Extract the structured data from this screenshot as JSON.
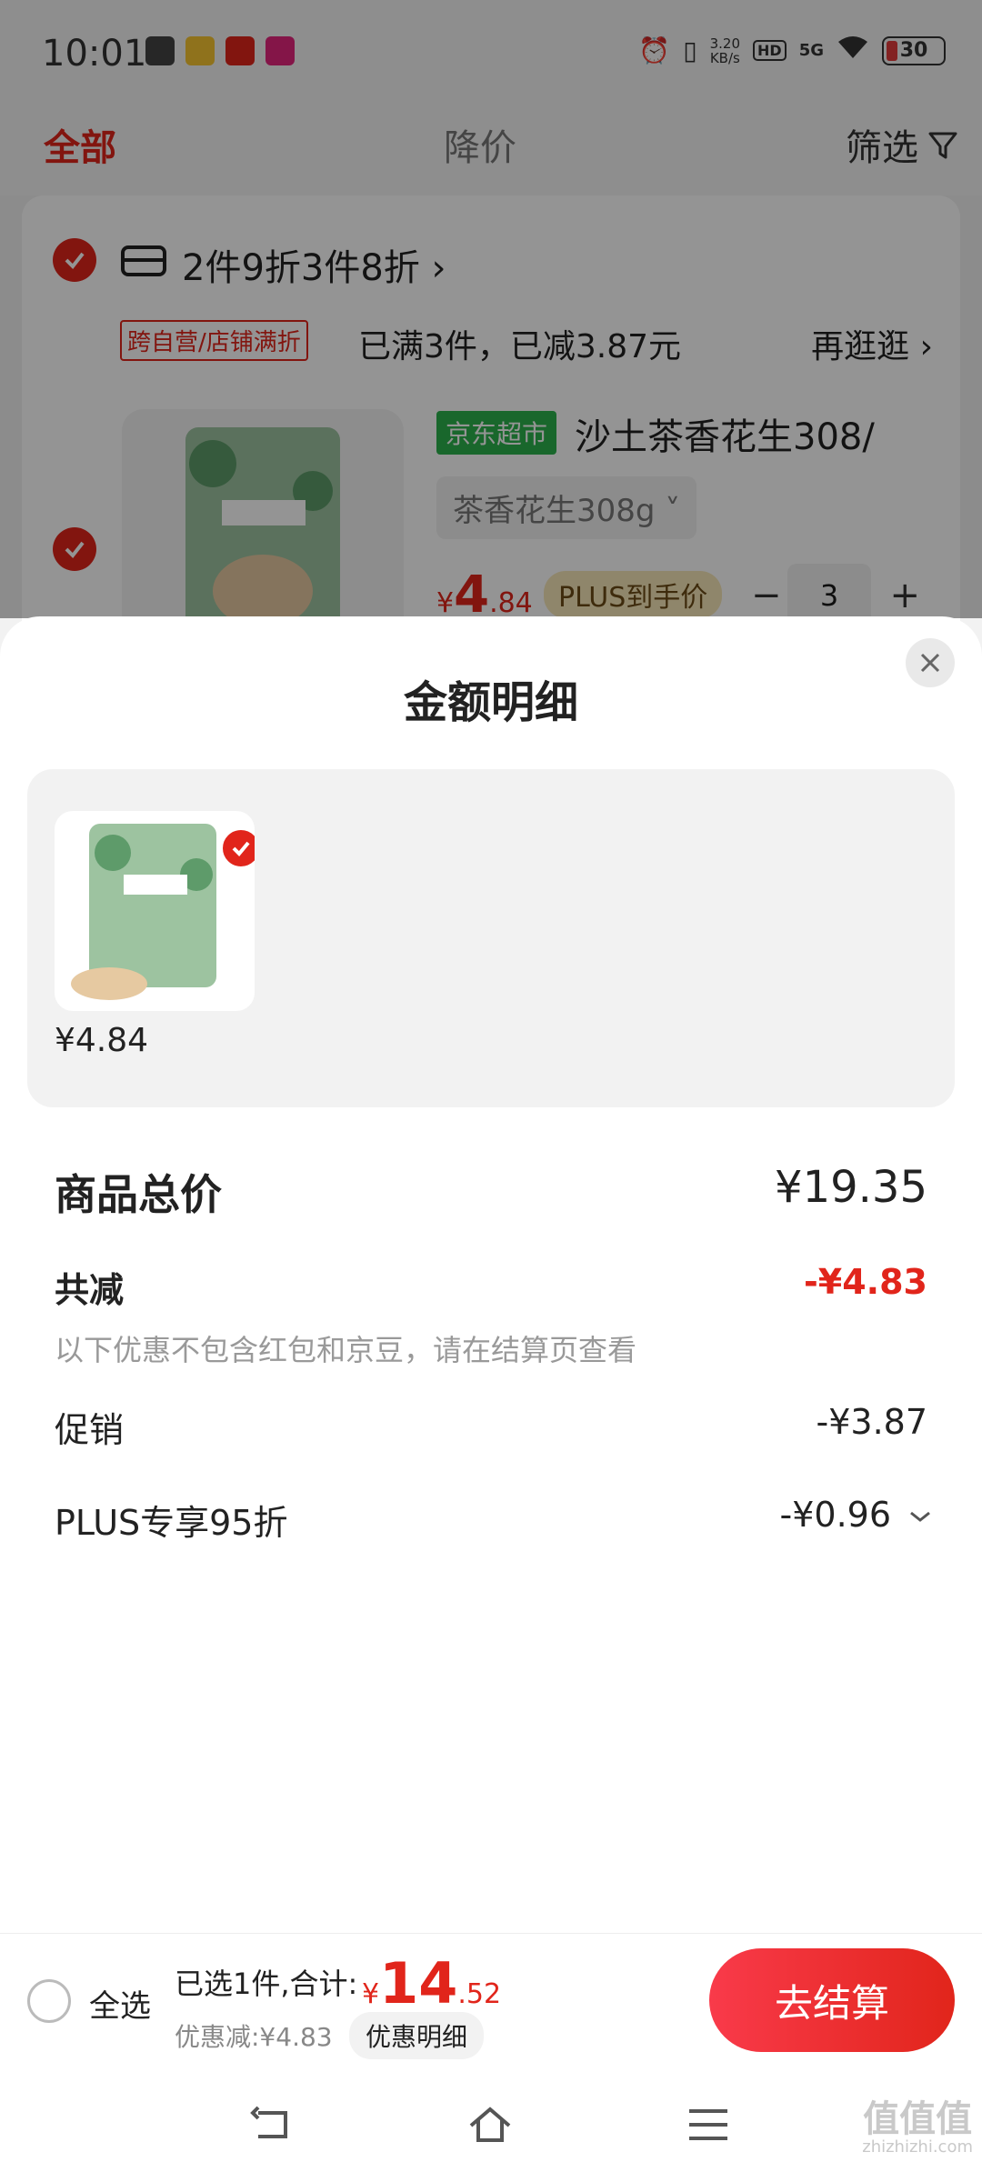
{
  "status": {
    "time": "10:01",
    "net_speed_top": "3.20",
    "net_speed_unit": "KB/s",
    "hd": "HD",
    "signal": "5G",
    "battery": "30"
  },
  "tabs": {
    "all": "全部",
    "price_drop": "降价",
    "filter": "筛选"
  },
  "promo": {
    "title": "2件9折3件8折 ›",
    "tag": "跨自营/店铺满折",
    "info": "已满3件，已减3.87元",
    "more": "再逛逛 ›"
  },
  "product": {
    "store_tag": "京东超市",
    "name": "沙土茶香花生308/",
    "variant": "茶香花生308g ˅",
    "price_symbol": "¥",
    "price_int": "4",
    "price_dec": ".84",
    "plus_label": "PLUS到手价",
    "qty_minus": "−",
    "qty": "3",
    "qty_plus": "+"
  },
  "sheet": {
    "title": "金额明细",
    "thumb_price": "¥4.84",
    "rows": {
      "total_label": "商品总价",
      "total_value": "¥19.35",
      "discount_label": "共减",
      "discount_value": "-¥4.83",
      "note": "以下优惠不包含红包和京豆，请在结算页查看",
      "promo_label": "促销",
      "promo_value": "-¥3.87",
      "plus_label": "PLUS专享95折",
      "plus_value": "-¥0.96"
    }
  },
  "footer": {
    "select_all": "全选",
    "summary": "已选1件,合计:",
    "price_symbol": "¥",
    "price_int": "14",
    "price_dec": ".52",
    "saved": "优惠减:¥4.83",
    "detail": "优惠明细",
    "checkout": "去结算"
  },
  "watermark": {
    "text": "值值值",
    "site": "zhizhizhi.com"
  },
  "colors": {
    "accent": "#e1251b",
    "jd_green": "#2bb24c",
    "plus_gold": "#f7e7b8"
  }
}
